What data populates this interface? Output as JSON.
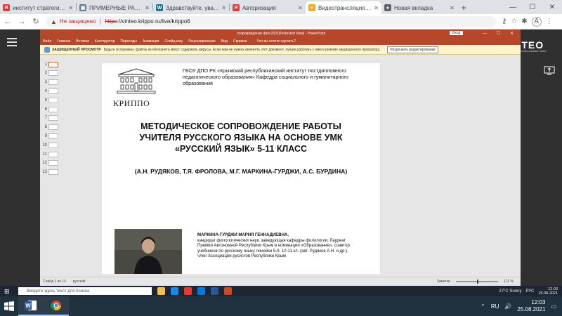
{
  "browser": {
    "tabs": [
      {
        "title": "институт стратегии ра",
        "favicon_color": "#e53935",
        "favicon_glyph": "Я"
      },
      {
        "title": "ПРИМЕРНЫЕ РАБОЧИЕ",
        "favicon_color": "#607d8b",
        "favicon_glyph": "▣"
      },
      {
        "title": "Здравствуйте, уважае",
        "favicon_color": "#21759b",
        "favicon_glyph": "W"
      },
      {
        "title": "Авторизация",
        "favicon_color": "#e53935",
        "favicon_glyph": "Я"
      },
      {
        "title": "Видеотрансляция - Vi",
        "favicon_color": "#f5a623",
        "favicon_glyph": "V",
        "active": true
      },
      {
        "title": "Новая вкладка",
        "favicon_color": "#5f6368",
        "favicon_glyph": "●"
      }
    ],
    "new_tab_label": "+",
    "address": {
      "security_label": "Не защищено",
      "scheme": "https",
      "rest": "://vinteo.krippo.ru/live/krippo6"
    },
    "profile_initial": "A"
  },
  "page": {
    "logo": "VINTEO",
    "logo_sub": "Unified Communication Suite"
  },
  "ppt": {
    "doc_title": "сопровождение фгос2021[Protected View] - PowerPoint",
    "login_label": "Вход",
    "ribbon_tabs": [
      "Файл",
      "Главная",
      "Вставка",
      "Конструктор",
      "Переходы",
      "Анимация",
      "Слайд-шоу",
      "Рецензирование",
      "Вид",
      "Справка"
    ],
    "ribbon_help": "Что вы хотите сделать?",
    "warning_title": "ЗАЩИЩЕННЫЙ ПРОСМОТР",
    "warning_text": "Будьте осторожны: файлы из Интернета могут содержать вирусы. Если вам не нужно изменять этот документ, лучше работать с ним в режиме защищенного просмотра.",
    "enable_editing": "Разрешить редактирование",
    "thumb_numbers": [
      "1",
      "2",
      "3",
      "4",
      "5",
      "6",
      "7",
      "8",
      "9",
      "10",
      "11",
      "12",
      "13"
    ],
    "status_left": "Слайд 1 из 13",
    "status_lang": "русский",
    "status_notes": "Заметки",
    "status_zoom": "121 %",
    "slide": {
      "header": "ГБОУ ДПО РК «Крымский республиканский институт постдипломного педагогического образования» Кафедра социального и гуманитарного образования",
      "org": "КРИППО",
      "title_l1": "МЕТОДИЧЕСКОЕ СОПРОВОЖДЕНИЕ РАБОТЫ",
      "title_l2": "УЧИТЕЛЯ РУССКОГО ЯЗЫКА НА ОСНОВЕ УМК",
      "title_l3": "«РУССКИЙ ЯЗЫК» 5-11 КЛАСС",
      "authors": "(А.Н. РУДЯКОВ, Т.Я. ФРОЛОВА, М.Г. МАРКИНА-ГУРДЖИ, А.С. БУРДИНА)",
      "bio_name": "МАРКИНА-ГУРДЖИ МАРИЯ ГЕННАДИЕВНА,",
      "bio_text": "кандидат филологических наук, заведующая кафедры филологии, Лауреат Премии Автономной Республики Крым в номинации «Образование», соавтор учебников по русскому языку линейки 5-9, 10-11 кл. (авт. Рудяков А.Н. и др.), член Ассоциации русистов Республики Крым"
    }
  },
  "remote_taskbar": {
    "search_placeholder": "Введите здесь текст для поиска",
    "weather": "27°C Sunny",
    "lang": "РУС",
    "time": "12:03",
    "date": "25.08.2021"
  },
  "host_taskbar": {
    "lang": "RU",
    "time": "12:03",
    "date": "25.08.2021"
  }
}
